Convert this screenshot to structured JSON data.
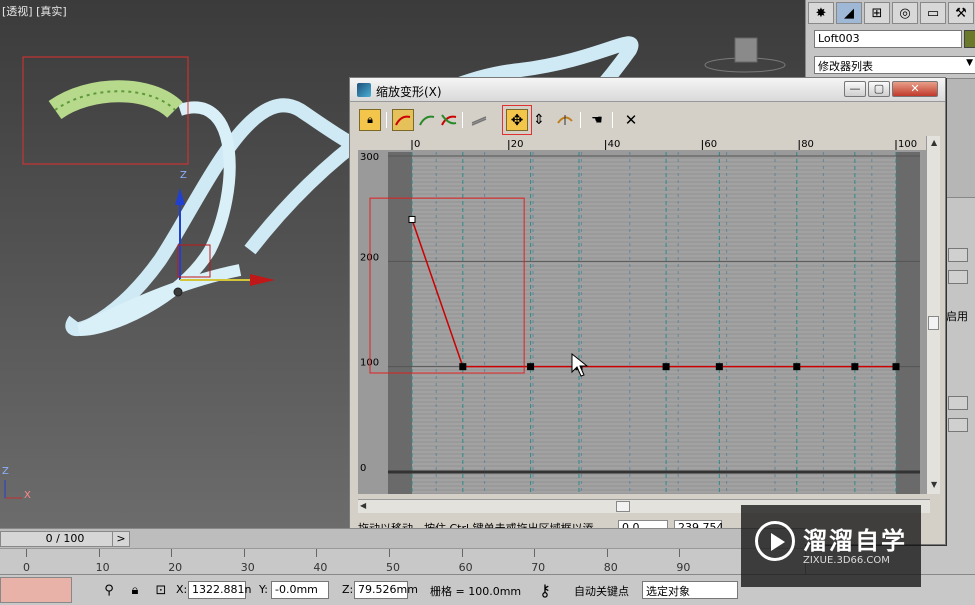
{
  "viewport": {
    "label": "[透视] [真实]",
    "gizmo_z": "Z",
    "corner_z": "Z",
    "corner_x": "X"
  },
  "command_panel": {
    "tab_icons": [
      "create-icon",
      "modify-icon",
      "hierarchy-icon",
      "motion-icon",
      "display-icon",
      "utilities-icon"
    ],
    "object_name": "Loft003",
    "object_color": "#6a7a2a",
    "modifier_list": "修改器列表",
    "enable_text": "启用"
  },
  "dialog": {
    "title": "缩放变形(X)",
    "toolbar": {
      "lock_icon": "lock-icon",
      "tools": [
        "make-symmetrical",
        "display-x-axis",
        "display-y-axis",
        "display-xy-axes",
        "swap-curves",
        "move-control-point",
        "scale-control-point",
        "insert-corner-point",
        "reset-curve",
        "delete-control-point"
      ],
      "active_tool": "move-control-point"
    },
    "graph": {
      "x_ticks": [
        "0",
        "20",
        "40",
        "60",
        "80",
        "100"
      ],
      "y_ticks": [
        "300",
        "200",
        "100",
        "0"
      ],
      "curve_color": "#cc0000",
      "selection_color": "#e02020"
    },
    "status_text": "拖动以移动。按住 Ctrl 键单击或拖出区域框以添",
    "x_value": "0.0",
    "y_value": "239.754"
  },
  "chart_data": {
    "type": "line",
    "xlim": [
      0,
      100
    ],
    "ylim": [
      0,
      300
    ],
    "x_ticks": [
      0,
      20,
      40,
      60,
      80,
      100
    ],
    "y_ticks": [
      0,
      100,
      200,
      300
    ],
    "series": [
      {
        "x": [
          0,
          10.5,
          24.5,
          34.5,
          52.5,
          63.5,
          79.5,
          91.5,
          100
        ],
        "values": [
          239.754,
          100,
          100,
          100,
          100,
          100,
          100,
          100,
          100
        ]
      }
    ]
  },
  "timeline": {
    "slider": "0 / 100",
    "next": ">",
    "ticks": [
      "0",
      "10",
      "20",
      "30",
      "40",
      "50",
      "60",
      "70",
      "80",
      "90"
    ]
  },
  "statusbar": {
    "x_label": "X:",
    "x_value": "1322.881n",
    "y_label": "Y:",
    "y_value": "-0.0mm",
    "z_label": "Z:",
    "z_value": "79.526mm",
    "grid": "栅格 = 100.0mm",
    "auto_key": "自动关键点",
    "selection": "选定对象"
  },
  "watermark": {
    "title": "溜溜自学",
    "url": "ZIXUE.3D66.COM"
  }
}
